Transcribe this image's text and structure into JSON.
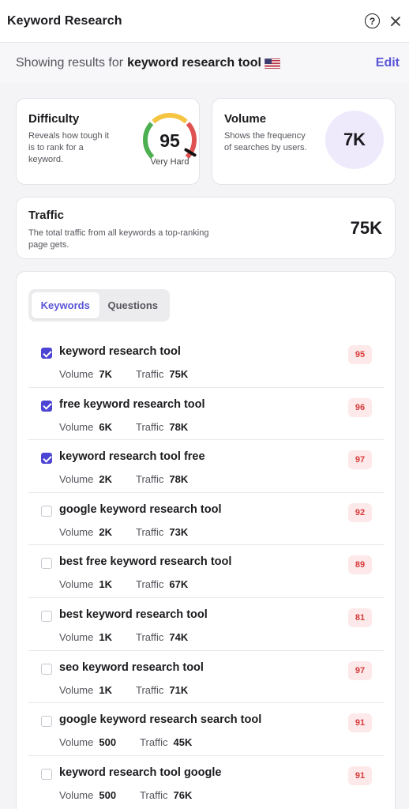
{
  "header": {
    "title": "Keyword Research",
    "help_icon": "question-circle-icon",
    "close_icon": "close-icon"
  },
  "results": {
    "prefix": "Showing results for",
    "keyword": "keyword research tool",
    "flag_icon": "us-flag-icon",
    "edit_label": "Edit"
  },
  "difficulty": {
    "title": "Difficulty",
    "description": "Reveals how tough it is to rank for a keyword.",
    "value": "95",
    "label": "Very Hard",
    "gauge_fraction": 0.95,
    "gauge_colors": [
      "#4caf50",
      "#f5c542",
      "#e05252"
    ]
  },
  "volume": {
    "title": "Volume",
    "description": "Shows the frequency of searches by users.",
    "value": "7K"
  },
  "traffic": {
    "title": "Traffic",
    "description": "The total traffic from all keywords a top-ranking page gets.",
    "value": "75K"
  },
  "tabs": [
    {
      "label": "Keywords",
      "active": true
    },
    {
      "label": "Questions",
      "active": false
    }
  ],
  "metric_labels": {
    "volume": "Volume",
    "traffic": "Traffic"
  },
  "keywords": [
    {
      "keyword": "keyword research tool",
      "volume": "7K",
      "traffic": "75K",
      "kd": "95",
      "checked": true
    },
    {
      "keyword": "free keyword research tool",
      "volume": "6K",
      "traffic": "78K",
      "kd": "96",
      "checked": true
    },
    {
      "keyword": "keyword research tool free",
      "volume": "2K",
      "traffic": "78K",
      "kd": "97",
      "checked": true
    },
    {
      "keyword": "google keyword research tool",
      "volume": "2K",
      "traffic": "73K",
      "kd": "92",
      "checked": false
    },
    {
      "keyword": "best free keyword research tool",
      "volume": "1K",
      "traffic": "67K",
      "kd": "89",
      "checked": false
    },
    {
      "keyword": "best keyword research tool",
      "volume": "1K",
      "traffic": "74K",
      "kd": "81",
      "checked": false
    },
    {
      "keyword": "seo keyword research tool",
      "volume": "1K",
      "traffic": "71K",
      "kd": "97",
      "checked": false
    },
    {
      "keyword": "google keyword research search tool",
      "volume": "500",
      "traffic": "45K",
      "kd": "91",
      "checked": false
    },
    {
      "keyword": "keyword research tool google",
      "volume": "500",
      "traffic": "76K",
      "kd": "91",
      "checked": false
    }
  ],
  "colors": {
    "accent": "#5a55d6",
    "checkbox": "#4c45d3",
    "badge_bg": "#fde9e9",
    "badge_text": "#d83b3b"
  }
}
